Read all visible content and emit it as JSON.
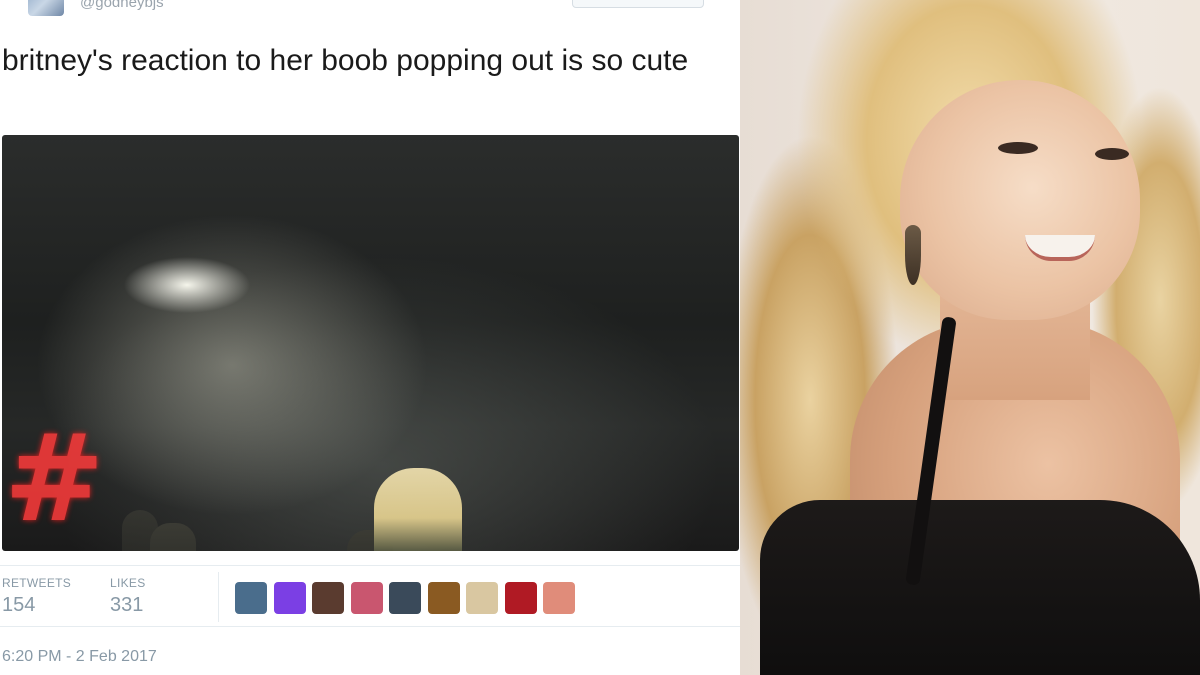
{
  "tweet": {
    "handle": "@godneybjs",
    "text": "britney's reaction to her boob popping out is so cute",
    "stats": {
      "retweets_label": "RETWEETS",
      "retweets_value": "154",
      "likes_label": "LIKES",
      "likes_value": "331"
    },
    "likers": [
      {
        "name": "liker-avatar-1",
        "color": "#4a6d8c"
      },
      {
        "name": "liker-avatar-2",
        "color": "#7b3fe4"
      },
      {
        "name": "liker-avatar-3",
        "color": "#5a3b2f"
      },
      {
        "name": "liker-avatar-4",
        "color": "#c9566f"
      },
      {
        "name": "liker-avatar-5",
        "color": "#3a4a5a"
      },
      {
        "name": "liker-avatar-6",
        "color": "#8a5a22"
      },
      {
        "name": "liker-avatar-7",
        "color": "#d9c7a1"
      },
      {
        "name": "liker-avatar-8",
        "color": "#b01a24"
      },
      {
        "name": "liker-avatar-9",
        "color": "#e08c7a"
      }
    ],
    "timestamp": "6:20 PM - 2 Feb 2017"
  },
  "colors": {
    "muted_text": "#8899a6",
    "border": "#e6ecf0"
  }
}
